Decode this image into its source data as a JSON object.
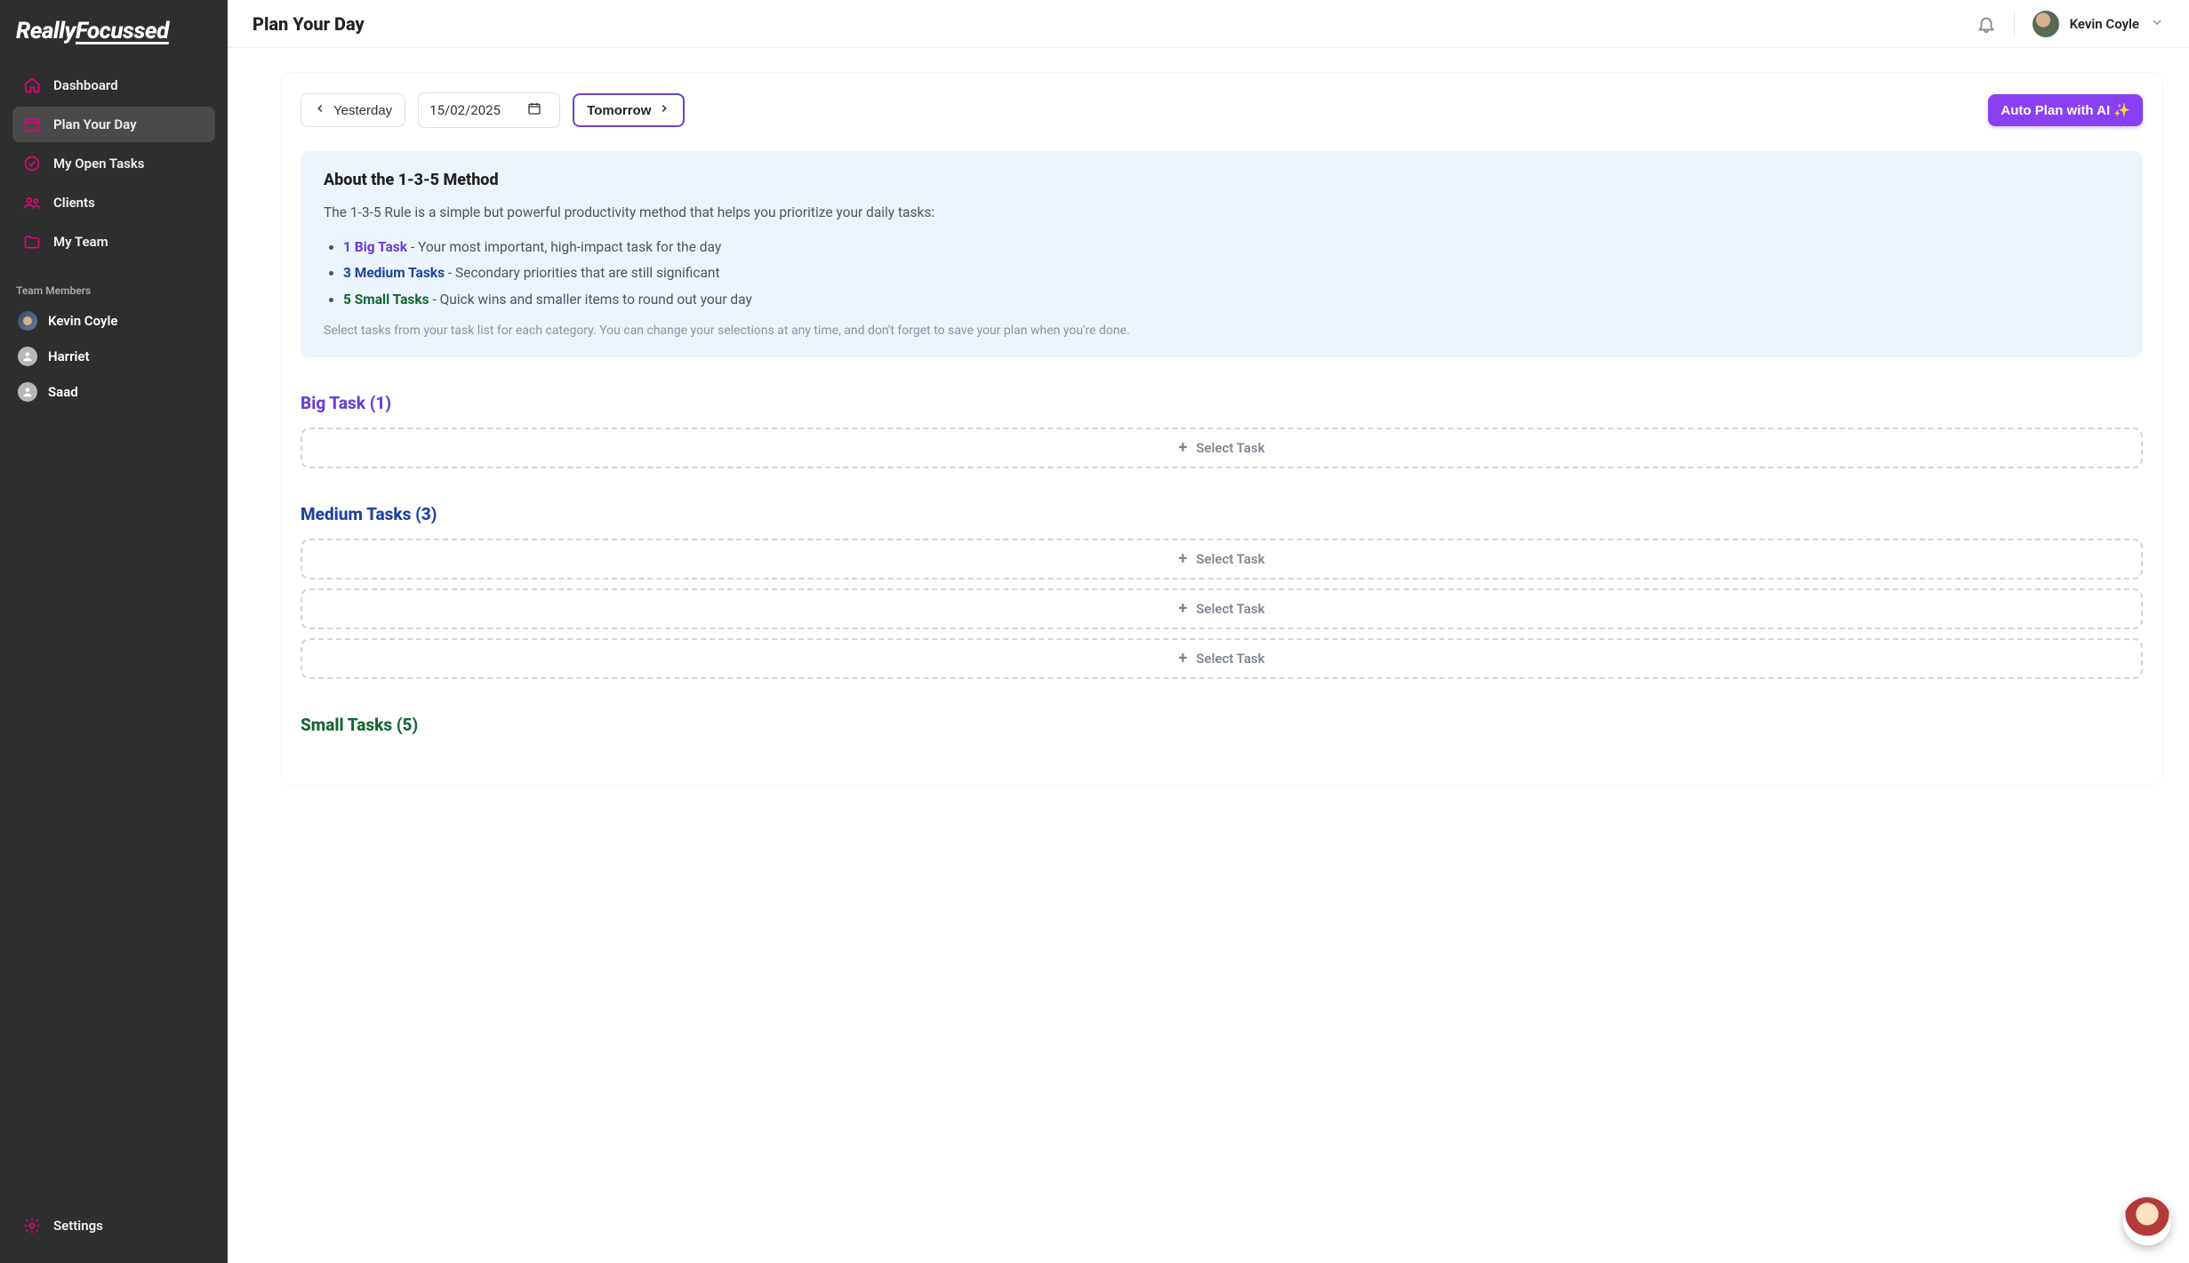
{
  "logo": {
    "part1": "Really",
    "part2": "Focussed"
  },
  "sidebar": {
    "items": [
      {
        "label": "Dashboard"
      },
      {
        "label": "Plan Your Day"
      },
      {
        "label": "My Open Tasks"
      },
      {
        "label": "Clients"
      },
      {
        "label": "My Team"
      }
    ],
    "team_section_label": "Team Members",
    "members": [
      {
        "name": "Kevin Coyle"
      },
      {
        "name": "Harriet"
      },
      {
        "name": "Saad"
      }
    ],
    "settings_label": "Settings"
  },
  "header": {
    "title": "Plan Your Day",
    "user_name": "Kevin Coyle"
  },
  "toolbar": {
    "yesterday_label": "Yesterday",
    "date_value": "15/02/2025",
    "tomorrow_label": "Tomorrow",
    "auto_plan_label": "Auto Plan with AI ✨"
  },
  "info": {
    "title": "About the 1-3-5 Method",
    "intro": "The 1-3-5 Rule is a simple but powerful productivity method that helps you prioritize your daily tasks:",
    "items": [
      {
        "bold": "1 Big Task",
        "rest": " - Your most important, high-impact task for the day"
      },
      {
        "bold": "3 Medium Tasks",
        "rest": " - Secondary priorities that are still significant"
      },
      {
        "bold": "5 Small Tasks",
        "rest": " - Quick wins and smaller items to round out your day"
      }
    ],
    "footer": "Select tasks from your task list for each category. You can change your selections at any time, and don't forget to save your plan when you're done."
  },
  "sections": {
    "big": {
      "title": "Big Task (1)",
      "slots": [
        {
          "label": "Select Task"
        }
      ]
    },
    "medium": {
      "title": "Medium Tasks (3)",
      "slots": [
        {
          "label": "Select Task"
        },
        {
          "label": "Select Task"
        },
        {
          "label": "Select Task"
        }
      ]
    },
    "small": {
      "title": "Small Tasks (5)"
    }
  }
}
